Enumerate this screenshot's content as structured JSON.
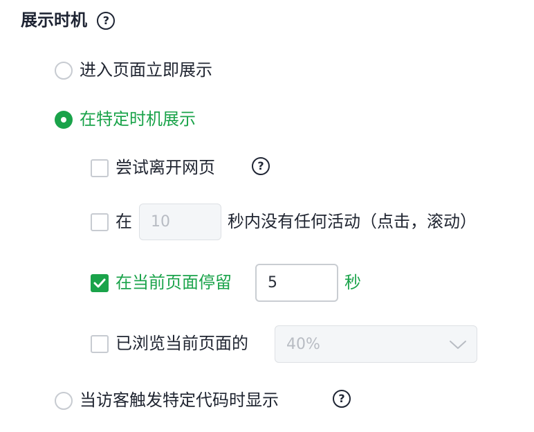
{
  "section": {
    "title": "展示时机"
  },
  "options": {
    "immediate": {
      "label": "进入页面立即展示",
      "selected": false
    },
    "specific_timing": {
      "label": "在特定时机展示",
      "selected": true
    },
    "code_trigger": {
      "label": "当访客触发特定代码时显示",
      "selected": false
    }
  },
  "conditions": {
    "leave_page": {
      "label": "尝试离开网页",
      "checked": false
    },
    "inactivity": {
      "prefix": "在",
      "value": "10",
      "suffix": "秒内没有任何活动（点击，滚动）",
      "checked": false
    },
    "stay": {
      "prefix": "在当前页面停留",
      "value": "5",
      "suffix": "秒",
      "checked": true
    },
    "scroll": {
      "prefix": "已浏览当前页面的",
      "selected_value": "40%",
      "checked": false
    }
  },
  "icons": {
    "help": "question-circle-icon",
    "check": "checkmark-icon",
    "dropdown": "chevron-down-icon"
  },
  "help_glyph": "?",
  "colors": {
    "accent": "#1aa34a",
    "text": "#1f2430",
    "border": "#c7cbd1",
    "disabled_bg": "#f4f6f8",
    "disabled_text": "#b8bcc3"
  }
}
